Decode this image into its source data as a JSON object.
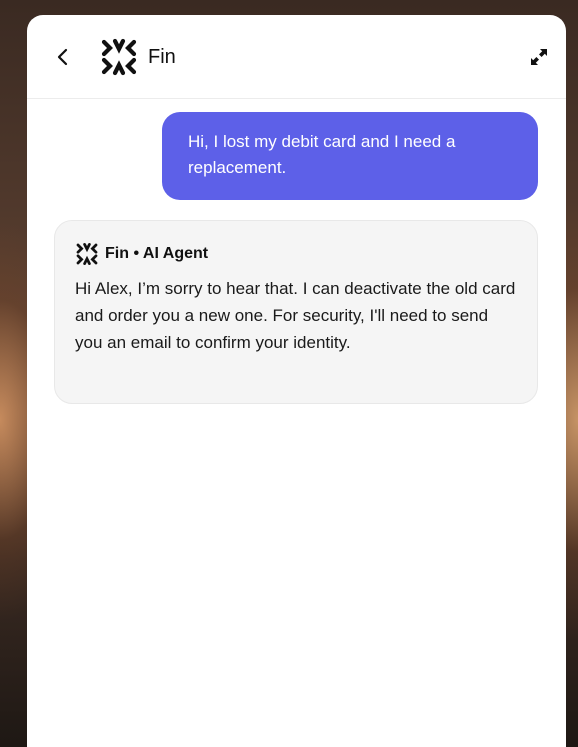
{
  "header": {
    "back_icon": "chevron-left-icon",
    "logo_icon": "fin-logo-icon",
    "title": "Fin",
    "expand_icon": "expand-icon"
  },
  "messages": {
    "user": {
      "text": "Hi, I lost my debit card and I need a replacement.",
      "bubble_color": "#5d60e8"
    },
    "agent": {
      "logo_icon": "fin-logo-icon",
      "name": "Fin",
      "separator": "•",
      "role": "AI Agent",
      "text": "Hi Alex, I’m sorry to hear that. I can deactivate the old card and order you a new one. For security, I'll need to send you an email to confirm your identity.",
      "bubble_color": "#f5f5f5"
    }
  }
}
